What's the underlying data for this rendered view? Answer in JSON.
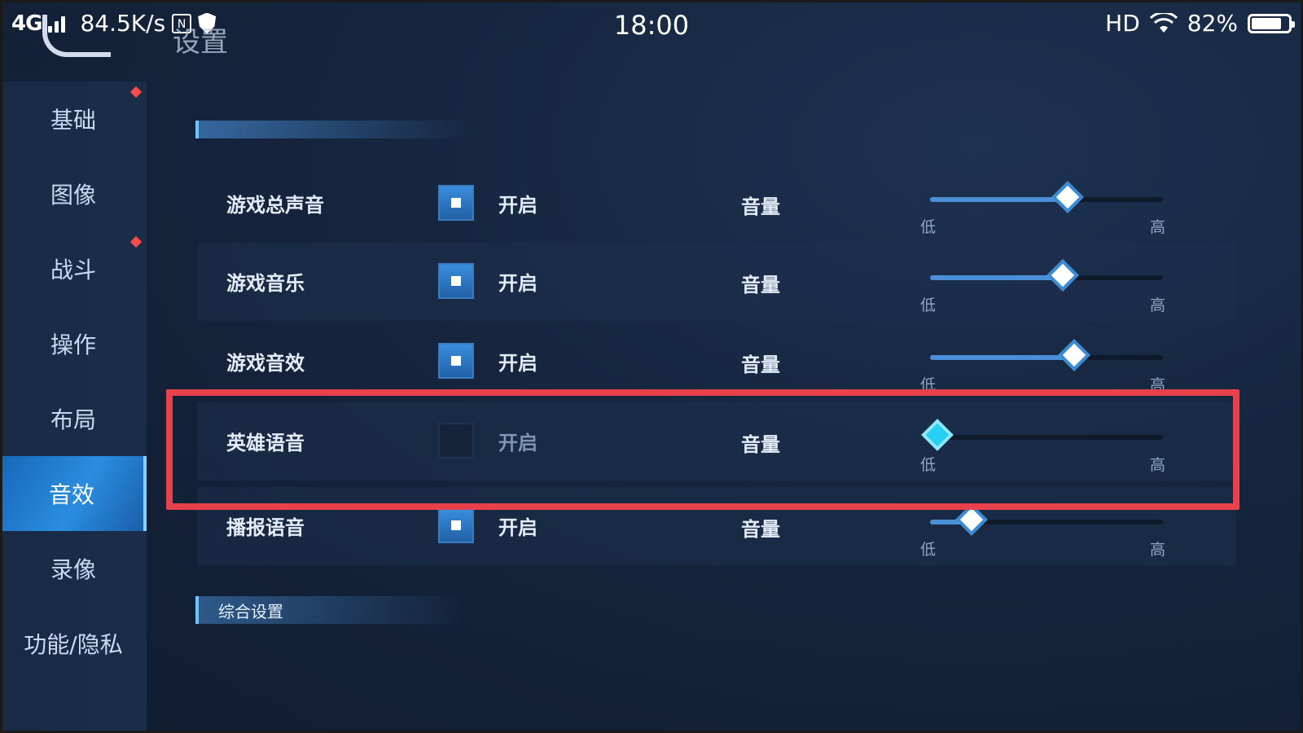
{
  "status_bar": {
    "network": "4G",
    "speed": "84.5K/s",
    "time": "18:00",
    "hd": "HD",
    "battery": "82%",
    "battery_level": 0.82,
    "small_icon": "N"
  },
  "header": {
    "title": "设置"
  },
  "sidebar": {
    "items": [
      {
        "label": "基础",
        "active": false
      },
      {
        "label": "图像",
        "active": false
      },
      {
        "label": "战斗",
        "active": false
      },
      {
        "label": "操作",
        "active": false
      },
      {
        "label": "布局",
        "active": false
      },
      {
        "label": "音效",
        "active": true
      },
      {
        "label": "录像",
        "active": false
      },
      {
        "label": "功能/隐私",
        "active": false
      }
    ]
  },
  "sections": {
    "general_settings": "综合设置"
  },
  "rows": [
    {
      "name": "游戏总声音",
      "toggle_label": "开启",
      "enabled": true,
      "volume_label": "音量",
      "low": "低",
      "high": "高",
      "volume": 0.59
    },
    {
      "name": "游戏音乐",
      "toggle_label": "开启",
      "enabled": true,
      "volume_label": "音量",
      "low": "低",
      "high": "高",
      "volume": 0.57
    },
    {
      "name": "游戏音效",
      "toggle_label": "开启",
      "enabled": true,
      "volume_label": "音量",
      "low": "低",
      "high": "高",
      "volume": 0.62
    },
    {
      "name": "英雄语音",
      "toggle_label": "开启",
      "enabled": false,
      "volume_label": "音量",
      "low": "低",
      "high": "高",
      "volume": 0.03
    },
    {
      "name": "播报语音",
      "toggle_label": "开启",
      "enabled": true,
      "volume_label": "音量",
      "low": "低",
      "high": "高",
      "volume": 0.18
    }
  ],
  "colors": {
    "highlight_border": "#e9414b",
    "active_tab": "#2a8de0",
    "knob_active": "#25d0f2"
  }
}
